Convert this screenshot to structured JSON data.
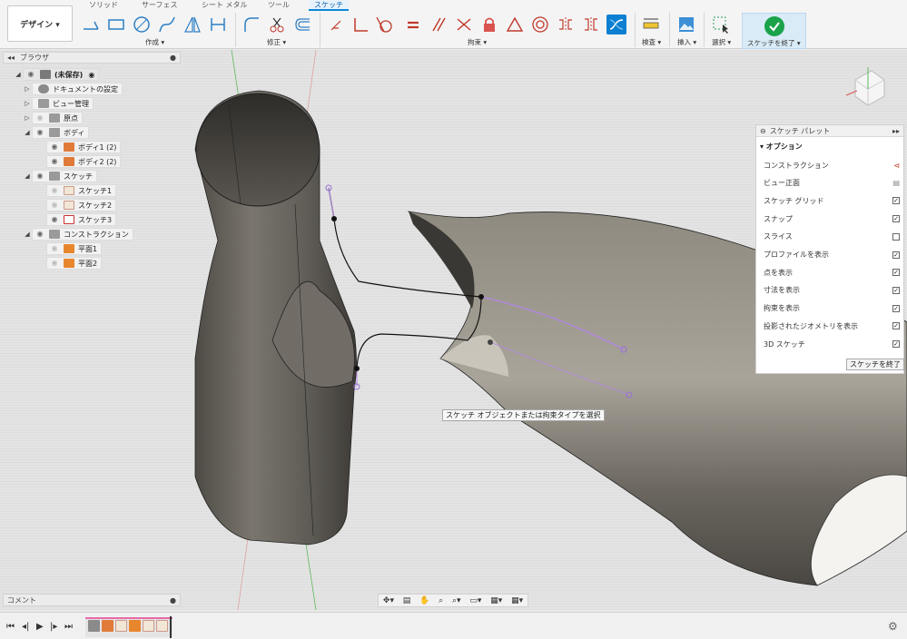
{
  "workspace": {
    "label": "デザイン ▾"
  },
  "tabs": [
    "ソリッド",
    "サーフェス",
    "シート メタル",
    "ツール",
    "スケッチ"
  ],
  "active_tab": "スケッチ",
  "groups": {
    "create": "作成 ▾",
    "modify": "修正 ▾",
    "constraints": "拘束 ▾",
    "inspect": "検査 ▾",
    "insert": "挿入 ▾",
    "select": "選択 ▾",
    "finish": "スケッチを終了 ▾"
  },
  "browser": {
    "title": "ブラウザ",
    "root": "(未保存)",
    "items": [
      "ドキュメントの設定",
      "ビュー管理",
      "原点",
      "ボディ",
      "ボディ1 (2)",
      "ボディ2 (2)",
      "スケッチ",
      "スケッチ1",
      "スケッチ2",
      "スケッチ3",
      "コンストラクション",
      "平面1",
      "平面2"
    ]
  },
  "palette": {
    "title": "スケッチ パレット",
    "section": "▾ オプション",
    "rows": [
      {
        "label": "コンストラクション",
        "checked": null
      },
      {
        "label": "ビュー正面",
        "checked": null
      },
      {
        "label": "スケッチ グリッド",
        "checked": true
      },
      {
        "label": "スナップ",
        "checked": true
      },
      {
        "label": "スライス",
        "checked": false
      },
      {
        "label": "プロファイルを表示",
        "checked": true
      },
      {
        "label": "点を表示",
        "checked": true
      },
      {
        "label": "寸法を表示",
        "checked": true
      },
      {
        "label": "拘束を表示",
        "checked": true
      },
      {
        "label": "投影されたジオメトリを表示",
        "checked": true
      },
      {
        "label": "3D スケッチ",
        "checked": true
      }
    ],
    "finish_button": "スケッチを終了"
  },
  "tooltip": "スケッチ オブジェクトまたは拘束タイプを選択",
  "comments": {
    "title": "コメント"
  },
  "colors": {
    "accent": "#0b7fd1",
    "body": "#6e6a62",
    "finish_green": "#1aa34a"
  }
}
